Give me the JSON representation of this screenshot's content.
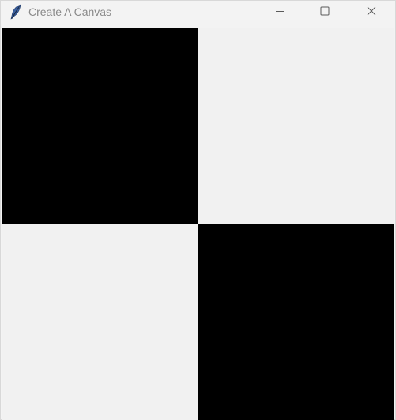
{
  "window": {
    "title": "Create A Canvas",
    "app_icon": "feather-icon",
    "controls": {
      "minimize_icon": "minimize-icon",
      "maximize_icon": "maximize-icon",
      "close_icon": "close-icon"
    }
  },
  "canvas": {
    "squares": [
      {
        "name": "top-left",
        "color": "#000000"
      },
      {
        "name": "top-right",
        "color": "#f1f1f1"
      },
      {
        "name": "bottom-left",
        "color": "#f1f1f1"
      },
      {
        "name": "bottom-right",
        "color": "#000000"
      }
    ]
  }
}
